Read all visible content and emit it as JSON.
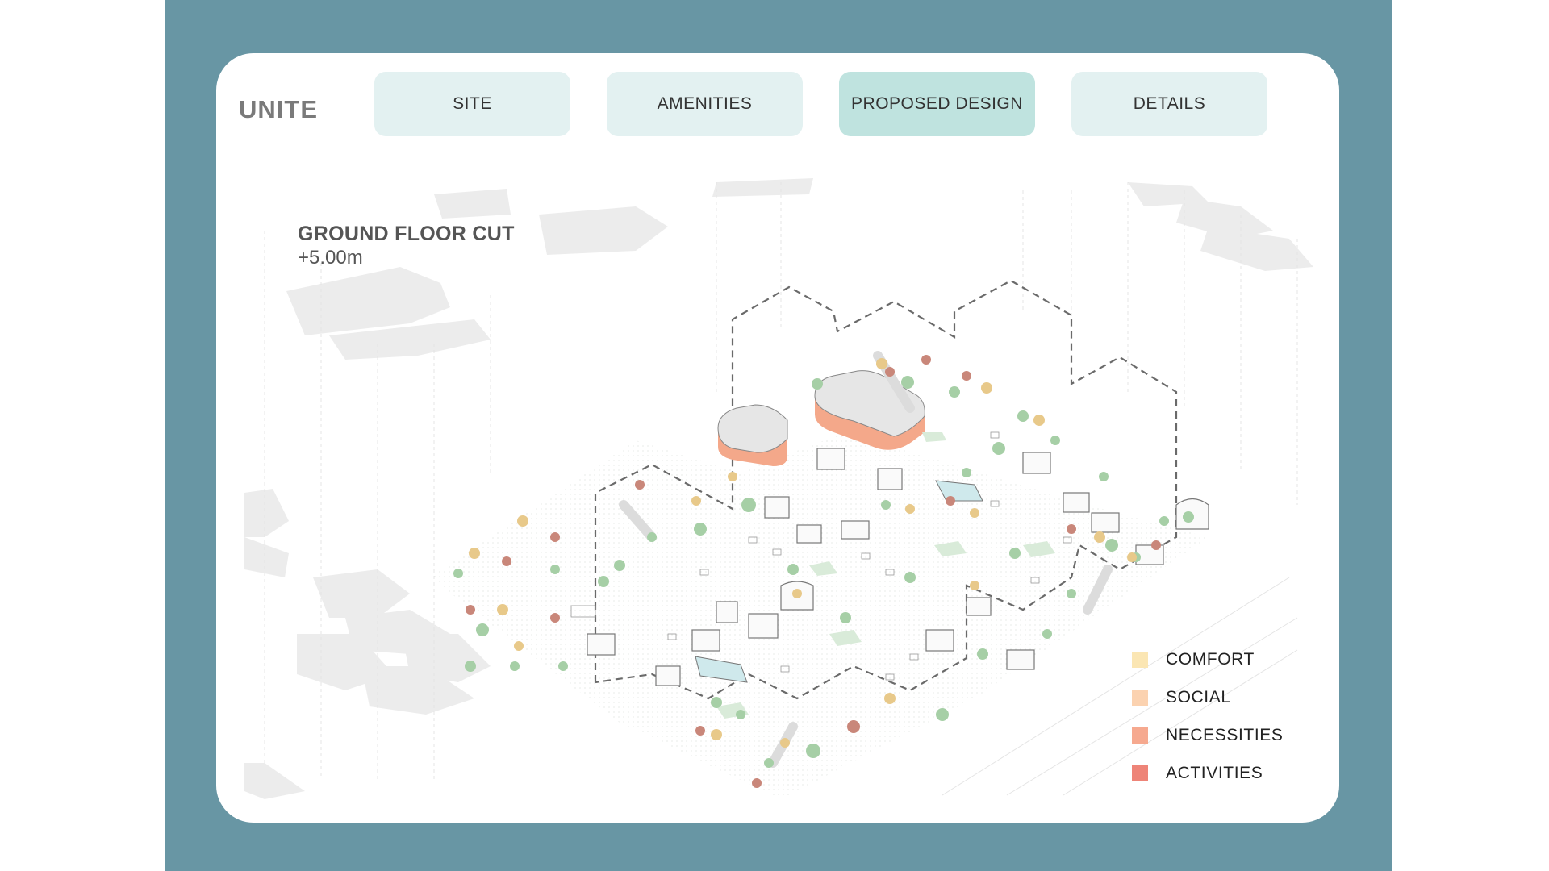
{
  "brand": "UNITE",
  "tabs": [
    {
      "label": "SITE",
      "active": false
    },
    {
      "label": "AMENITIES",
      "active": false
    },
    {
      "label": "PROPOSED DESIGN",
      "active": true
    },
    {
      "label": "DETAILS",
      "active": false
    }
  ],
  "plan": {
    "title": "GROUND FLOOR CUT",
    "subtitle": "+5.00m"
  },
  "legend": [
    {
      "label": "COMFORT",
      "color": "#fbe6b3"
    },
    {
      "label": "SOCIAL",
      "color": "#fbd2b0"
    },
    {
      "label": "NECESSITIES",
      "color": "#f6a98f"
    },
    {
      "label": "ACTIVITIES",
      "color": "#ee8478"
    }
  ],
  "colors": {
    "frame": "#6896a4",
    "tab": "#e3f1f1",
    "tab_active": "#bfe3df",
    "tree_green": "#a6cfa6",
    "tree_yellow": "#e8c98a",
    "tree_red": "#c9877a",
    "building_accent": "#f4a88a"
  }
}
